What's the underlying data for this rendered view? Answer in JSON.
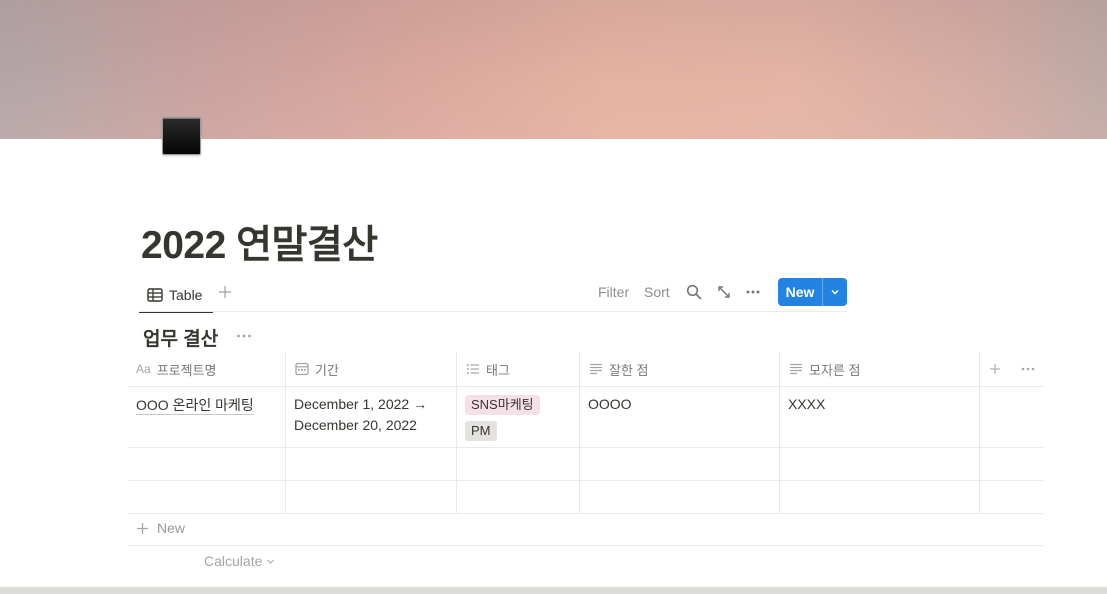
{
  "page": {
    "title": "2022 연말결산",
    "icon": "black-square-icon"
  },
  "colors": {
    "accent": "#2383e2",
    "tag_sns_bg": "#f5e0e9",
    "tag_pm_bg": "#e3e2e0",
    "text": "#37352f",
    "muted": "#787774"
  },
  "view": {
    "tab_label": "Table",
    "tab_icon": "table-icon",
    "add_view_icon": "plus-icon"
  },
  "toolbar": {
    "filter_label": "Filter",
    "sort_label": "Sort",
    "search_icon": "search-icon",
    "expand_icon": "expand-arrows-icon",
    "more_icon": "more-dots-icon",
    "new_label": "New",
    "new_dropdown_icon": "chevron-down-icon"
  },
  "database": {
    "title": "업무 결산",
    "columns": [
      {
        "label": "프로젝트명",
        "icon": "text-aa-icon"
      },
      {
        "label": "기간",
        "icon": "calendar-icon"
      },
      {
        "label": "태그",
        "icon": "list-icon"
      },
      {
        "label": "잘한 점",
        "icon": "text-lines-icon"
      },
      {
        "label": "모자른 점",
        "icon": "text-lines-icon"
      }
    ],
    "rows": [
      {
        "name": "OOO 온라인 마케팅",
        "period_line1": "December 1, 2022 →",
        "period_line2": "December 20, 2022",
        "tags": [
          "SNS마케팅",
          "PM"
        ],
        "good": "OOOO",
        "bad": "XXXX"
      }
    ],
    "new_row_label": "New",
    "calculate_label": "Calculate"
  }
}
